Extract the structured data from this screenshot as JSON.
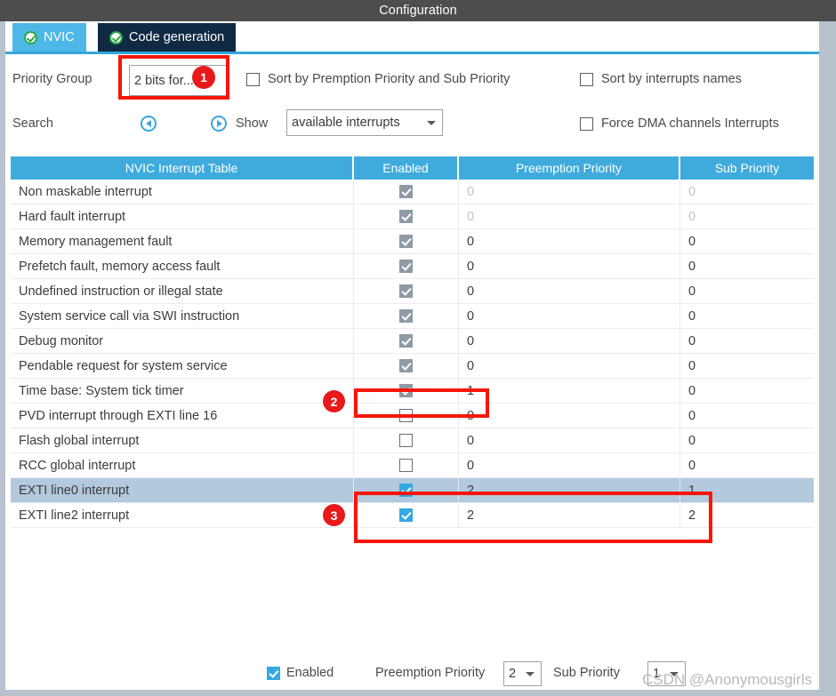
{
  "window": {
    "title": "Configuration"
  },
  "tabs": [
    {
      "label": "NVIC",
      "icon": "check-circle-icon",
      "active": true
    },
    {
      "label": "Code generation",
      "icon": "check-circle-icon",
      "active": false
    }
  ],
  "options": {
    "priority_group_label": "Priority Group",
    "priority_group_value": "2 bits for...",
    "sort_premption_label": "Sort by Premption Priority and Sub Priority",
    "sort_premption_checked": false,
    "sort_names_label": "Sort by interrupts names",
    "sort_names_checked": false,
    "search_label": "Search",
    "search_prev_icon": "circle-arrow-left-icon",
    "search_next_icon": "circle-arrow-right-icon",
    "show_label": "Show",
    "show_value": "available interrupts",
    "force_dma_label": "Force DMA channels Interrupts",
    "force_dma_checked": false
  },
  "table": {
    "headers": [
      "NVIC Interrupt Table",
      "Enabled",
      "Preemption Priority",
      "Sub Priority"
    ],
    "rows": [
      {
        "name": "Non maskable interrupt",
        "enabled": "disabled-checked",
        "pre": "0",
        "sub": "0",
        "dim": true,
        "selected": false
      },
      {
        "name": "Hard fault interrupt",
        "enabled": "disabled-checked",
        "pre": "0",
        "sub": "0",
        "dim": true,
        "selected": false
      },
      {
        "name": "Memory management fault",
        "enabled": "disabled-checked",
        "pre": "0",
        "sub": "0",
        "dim": false,
        "selected": false
      },
      {
        "name": "Prefetch fault, memory access fault",
        "enabled": "disabled-checked",
        "pre": "0",
        "sub": "0",
        "dim": false,
        "selected": false
      },
      {
        "name": "Undefined instruction or illegal state",
        "enabled": "disabled-checked",
        "pre": "0",
        "sub": "0",
        "dim": false,
        "selected": false
      },
      {
        "name": "System service call via SWI instruction",
        "enabled": "disabled-checked",
        "pre": "0",
        "sub": "0",
        "dim": false,
        "selected": false
      },
      {
        "name": "Debug monitor",
        "enabled": "disabled-checked",
        "pre": "0",
        "sub": "0",
        "dim": false,
        "selected": false
      },
      {
        "name": "Pendable request for system service",
        "enabled": "disabled-checked",
        "pre": "0",
        "sub": "0",
        "dim": false,
        "selected": false
      },
      {
        "name": "Time base: System tick timer",
        "enabled": "disabled-checked",
        "pre": "1",
        "sub": "0",
        "dim": false,
        "selected": false
      },
      {
        "name": "PVD interrupt through EXTI line 16",
        "enabled": "unchecked",
        "pre": "0",
        "sub": "0",
        "dim": false,
        "selected": false
      },
      {
        "name": "Flash global interrupt",
        "enabled": "unchecked",
        "pre": "0",
        "sub": "0",
        "dim": false,
        "selected": false
      },
      {
        "name": "RCC global interrupt",
        "enabled": "unchecked",
        "pre": "0",
        "sub": "0",
        "dim": false,
        "selected": false
      },
      {
        "name": "EXTI line0 interrupt",
        "enabled": "checked",
        "pre": "2",
        "sub": "1",
        "dim": false,
        "selected": true
      },
      {
        "name": "EXTI line2 interrupt",
        "enabled": "checked",
        "pre": "2",
        "sub": "2",
        "dim": false,
        "selected": false
      }
    ]
  },
  "bottom": {
    "enabled_label": "Enabled",
    "enabled_checked": true,
    "preemption_label": "Preemption Priority",
    "preemption_value": "2",
    "sub_label": "Sub Priority",
    "sub_value": "1"
  },
  "annotations": {
    "badge1": "1",
    "badge2": "2",
    "badge3": "3"
  },
  "watermark": {
    "text": "CSDN @Anonymousgirls"
  },
  "colors": {
    "titlebar": "#4d4d4d",
    "tab_active": "#4db8e8",
    "tab_inactive": "#102a43",
    "table_header": "#3fabdd",
    "row_selected": "#b2c9de",
    "checkbox_on": "#34a8e0",
    "checkbox_disabled": "#8f9aa5",
    "annotation_red": "#f71607",
    "frame": "#b7c2cc"
  }
}
